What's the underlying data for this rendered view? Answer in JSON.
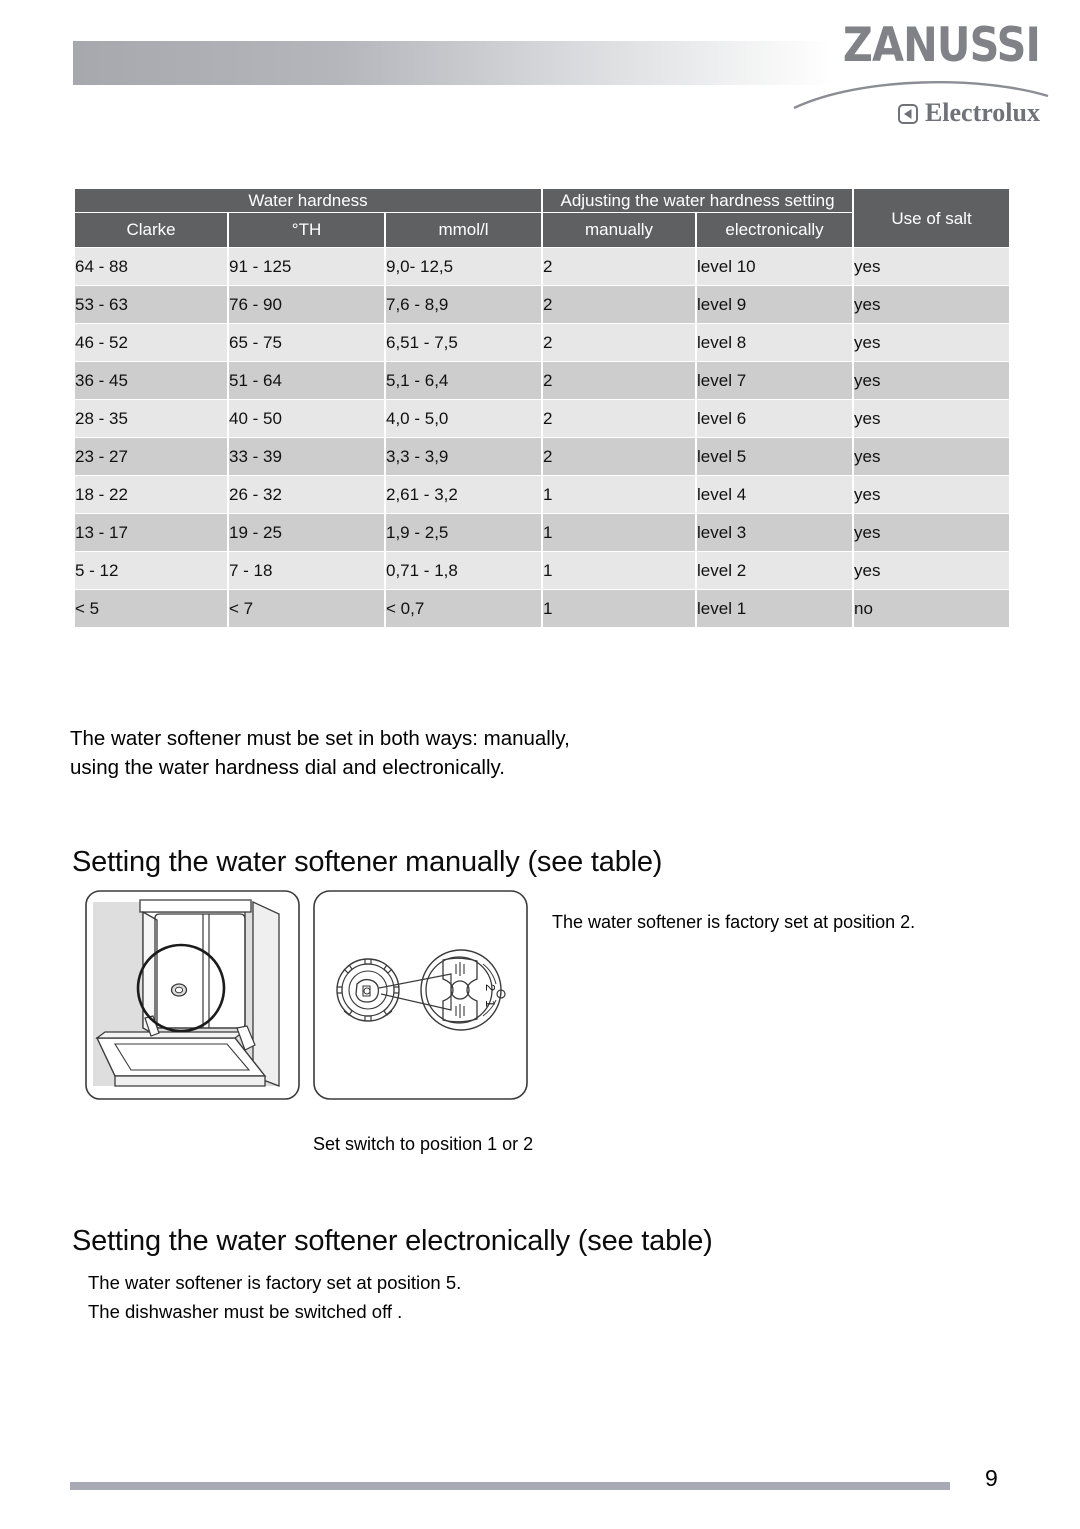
{
  "header": {
    "brand": "ZANUSSI",
    "sub_brand": "Electrolux",
    "brand_mark_icon": "electrolux-triangle-icon"
  },
  "table": {
    "group_headers": [
      {
        "label": "Water hardness",
        "span": 3
      },
      {
        "label": "Adjusting the water hardness setting",
        "span": 2
      },
      {
        "label": "Use of salt",
        "span": 1
      }
    ],
    "sub_headers": [
      "Clarke",
      "°TH",
      "mmol/l",
      "manually",
      "electronically"
    ],
    "rows": [
      {
        "clarke": "64 - 88",
        "th": "91 - 125",
        "mmol": "9,0- 12,5",
        "manually": "2",
        "electronically": "level 10",
        "salt": "yes"
      },
      {
        "clarke": "53 - 63",
        "th": "76 - 90",
        "mmol": "7,6 - 8,9",
        "manually": "2",
        "electronically": "level 9",
        "salt": "yes"
      },
      {
        "clarke": "46 - 52",
        "th": "65 - 75",
        "mmol": "6,51 - 7,5",
        "manually": "2",
        "electronically": "level 8",
        "salt": "yes"
      },
      {
        "clarke": "36 - 45",
        "th": "51 - 64",
        "mmol": "5,1 - 6,4",
        "manually": "2",
        "electronically": "level 7",
        "salt": "yes"
      },
      {
        "clarke": "28 - 35",
        "th": "40 - 50",
        "mmol": "4,0 - 5,0",
        "manually": "2",
        "electronically": "level 6",
        "salt": "yes"
      },
      {
        "clarke": "23 - 27",
        "th": "33 - 39",
        "mmol": "3,3 - 3,9",
        "manually": "2",
        "electronically": "level 5",
        "salt": "yes"
      },
      {
        "clarke": "18 - 22",
        "th": "26 - 32",
        "mmol": "2,61 - 3,2",
        "manually": "1",
        "electronically": "level 4",
        "salt": "yes"
      },
      {
        "clarke": "13 - 17",
        "th": "19 - 25",
        "mmol": "1,9 - 2,5",
        "manually": "1",
        "electronically": "level 3",
        "salt": "yes"
      },
      {
        "clarke": "5 - 12",
        "th": "7 - 18",
        "mmol": "0,71 - 1,8",
        "manually": "1",
        "electronically": "level 2",
        "salt": "yes"
      },
      {
        "clarke": "< 5",
        "th": "< 7",
        "mmol": "< 0,7",
        "manually": "1",
        "electronically": "level 1",
        "salt": "no"
      }
    ]
  },
  "body": {
    "intro": "The water softener must be set in both ways: manually, using the water hardness dial and electronically.",
    "heading_manual": "Setting the water softener manually (see table)",
    "factory_position_2": "The water softener is factory set at position 2.",
    "caption_switch": "Set switch to position 1 or 2",
    "heading_electronic": "Setting the water softener electronically (see table)",
    "electronic_line_1": "The water softener is factory set at position 5.",
    "electronic_line_2": "The dishwasher must be switched off ."
  },
  "illustrations": {
    "left": "dishwasher-open-door-dial-location-illustration",
    "right": "water-hardness-dial-detail-illustration",
    "dial_marks": [
      "2",
      "1"
    ]
  },
  "footer": {
    "page_number": "9"
  },
  "colors": {
    "header_bar_start": "#a6a8ad",
    "table_header_bg": "#5f6062",
    "row_light": "#e7e7e7",
    "row_dark": "#cdcdcd",
    "footer_rule": "#a7aab4",
    "logo_gray": "#808287"
  }
}
